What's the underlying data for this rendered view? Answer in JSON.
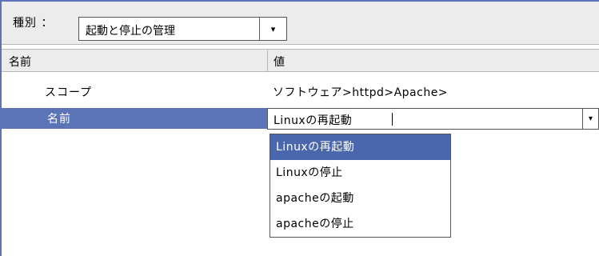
{
  "type_filter": {
    "label": "種別 ：",
    "selected": "起動と停止の管理",
    "arrow": "▾"
  },
  "table": {
    "headers": [
      "名前",
      "値"
    ],
    "scope_row": {
      "key": "スコープ",
      "value": "ソフトウェア>httpd>Apache>"
    },
    "name_row": {
      "key": "名前",
      "value": "Linuxの再起動",
      "arrow": "▾"
    }
  },
  "dropdown": {
    "options": [
      "Linuxの再起動",
      "Linuxの停止",
      "apacheの起動",
      "apacheの停止"
    ],
    "selected_index": 0
  },
  "colors": {
    "selection": "#4a67ad",
    "frame": "#5b74b8"
  }
}
